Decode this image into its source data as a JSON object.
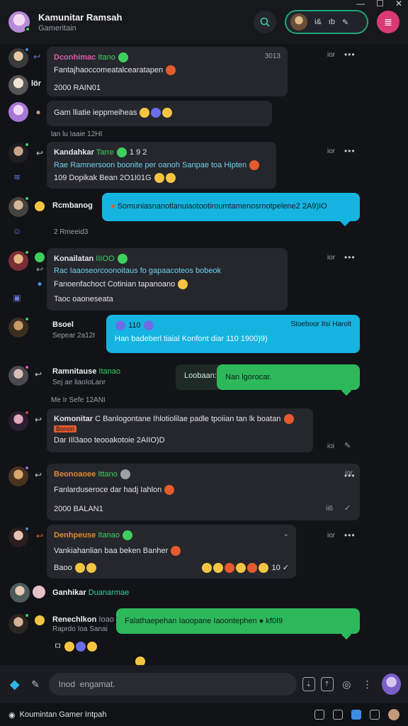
{
  "window": {
    "minimize": "—",
    "maximize": "☐",
    "close": "✕"
  },
  "header": {
    "title": "Kamunitar Ramsah",
    "subtitle": "Gameritain",
    "pill_a": "i&",
    "pill_b": "ıb"
  },
  "messages": {
    "m1": {
      "name": "Dconhimac",
      "tag": "Itano",
      "time": "3013",
      "side_time": "ior",
      "line1": "Fantajhaoccomeatalcearatapen",
      "line2": "2000 RAIN01",
      "name_color": "#e05ba8"
    },
    "m1_sender": "lör",
    "m2": {
      "text": "Gam  lliatie ieppmeiheas"
    },
    "sep1": "lan lu  Iaaie  12HI",
    "m3": {
      "name": "Kandahkar",
      "tag": "Tarre",
      "extra": "1 9 2",
      "time": "ior",
      "line1": "Rae  Ramnersoon boonite  per  oanoh  Sanpae  toa  Hipten",
      "line2": "109  Dopikak  Bean  2O1I01G"
    },
    "m4_sender": "Rcmbanog",
    "m4_text": "Somuniasnanotlanuiaotootiroumtamenosrnotpelene2 2A9)IO",
    "m4_meta": "2  Rmeeid3",
    "m5": {
      "name": "Konailatan",
      "tag": "IIIOO",
      "time": "ior",
      "line1": "Rac  Iaaoseorcoonoitaus  fo  gapaacoteos  bobeok",
      "line2": "Fanoenfachoct  Cotinian  tapanoano",
      "line3": "Taoc oaoneseata"
    },
    "m6_sender": "Bsoel",
    "m6_meta": "Sepear 2a12I",
    "m6": {
      "head_left": "110",
      "head_right": "Stoeboor  IIsi  Harolt",
      "line": "Han badeberl  tiaial  Konfont  diar 110 1900)9)"
    },
    "m7_sender": "Ramnitause",
    "m7_tag": "Itanao",
    "m7_meta": "Sej  ae  liaoIoLanr",
    "m7_label": "Loobaan:",
    "m7_text": "Nan lgorocar.",
    "sep2": "Me  Ir  Sefe  12ANI",
    "m8": {
      "name": "Komonitar",
      "line1": "C Banlogontane  Ihlotiolilae  padle  tpoiian  tan  lk  boatan",
      "tag": "Bonon",
      "line2": "Dar  IIl3aoo  teooakotoie  2AIIO)D",
      "time": "ioi"
    },
    "m9": {
      "name": "Beonoaoee",
      "tag": "Ittano",
      "time": "ior",
      "line1": "Fanlarduseroce  dar  hadj  Iahlon",
      "line2": "2000 BALAN1",
      "side_time": "ii6"
    },
    "m10": {
      "name": "Denhpeuse",
      "tag": "Itanao",
      "time": "ior",
      "line1": "Vankiahanlian  baa  beken  Banher",
      "line2": "Baoo",
      "reactions": "10"
    },
    "m11_sender": "Ganhikar",
    "m11_tag": "Duanarmae",
    "m12_sender": "Renechlkon",
    "m12_tag": "Ioao",
    "m12_meta": "Raprdo  Ioa  Sanai",
    "m12_text": "Falathaepehan  Iaoopane  Iaoontephen  ●  kf0I9"
  },
  "composer": {
    "placeholder": "Inod  engamat."
  },
  "status": {
    "label": "Koumintan Gamer Intpah"
  },
  "colors": {
    "accent_cyan": "#15b4e0",
    "accent_green": "#2eb85c",
    "badge_pink": "#d93a74"
  },
  "icons": [
    "search-icon",
    "pin-icon",
    "attach-icon",
    "send-icon",
    "emoji-icon",
    "more-icon",
    "check-icon"
  ]
}
